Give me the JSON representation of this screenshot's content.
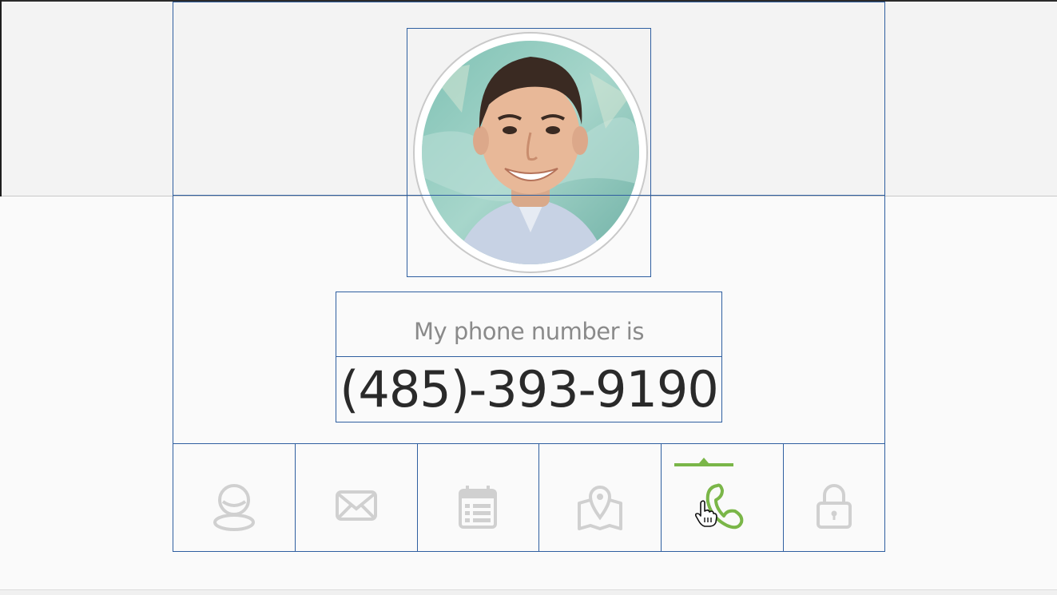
{
  "profile": {
    "label": "My phone number is",
    "value": "(485)-393-9190",
    "avatar_alt": "user-photo"
  },
  "icon_bar": {
    "items": [
      {
        "name": "user-icon",
        "active": false
      },
      {
        "name": "envelope-icon",
        "active": false
      },
      {
        "name": "calendar-icon",
        "active": false
      },
      {
        "name": "map-icon",
        "active": false
      },
      {
        "name": "phone-icon",
        "active": true
      },
      {
        "name": "lock-icon",
        "active": false
      }
    ],
    "inactive_color": "#d0d0d0",
    "active_color": "#7ab648"
  }
}
